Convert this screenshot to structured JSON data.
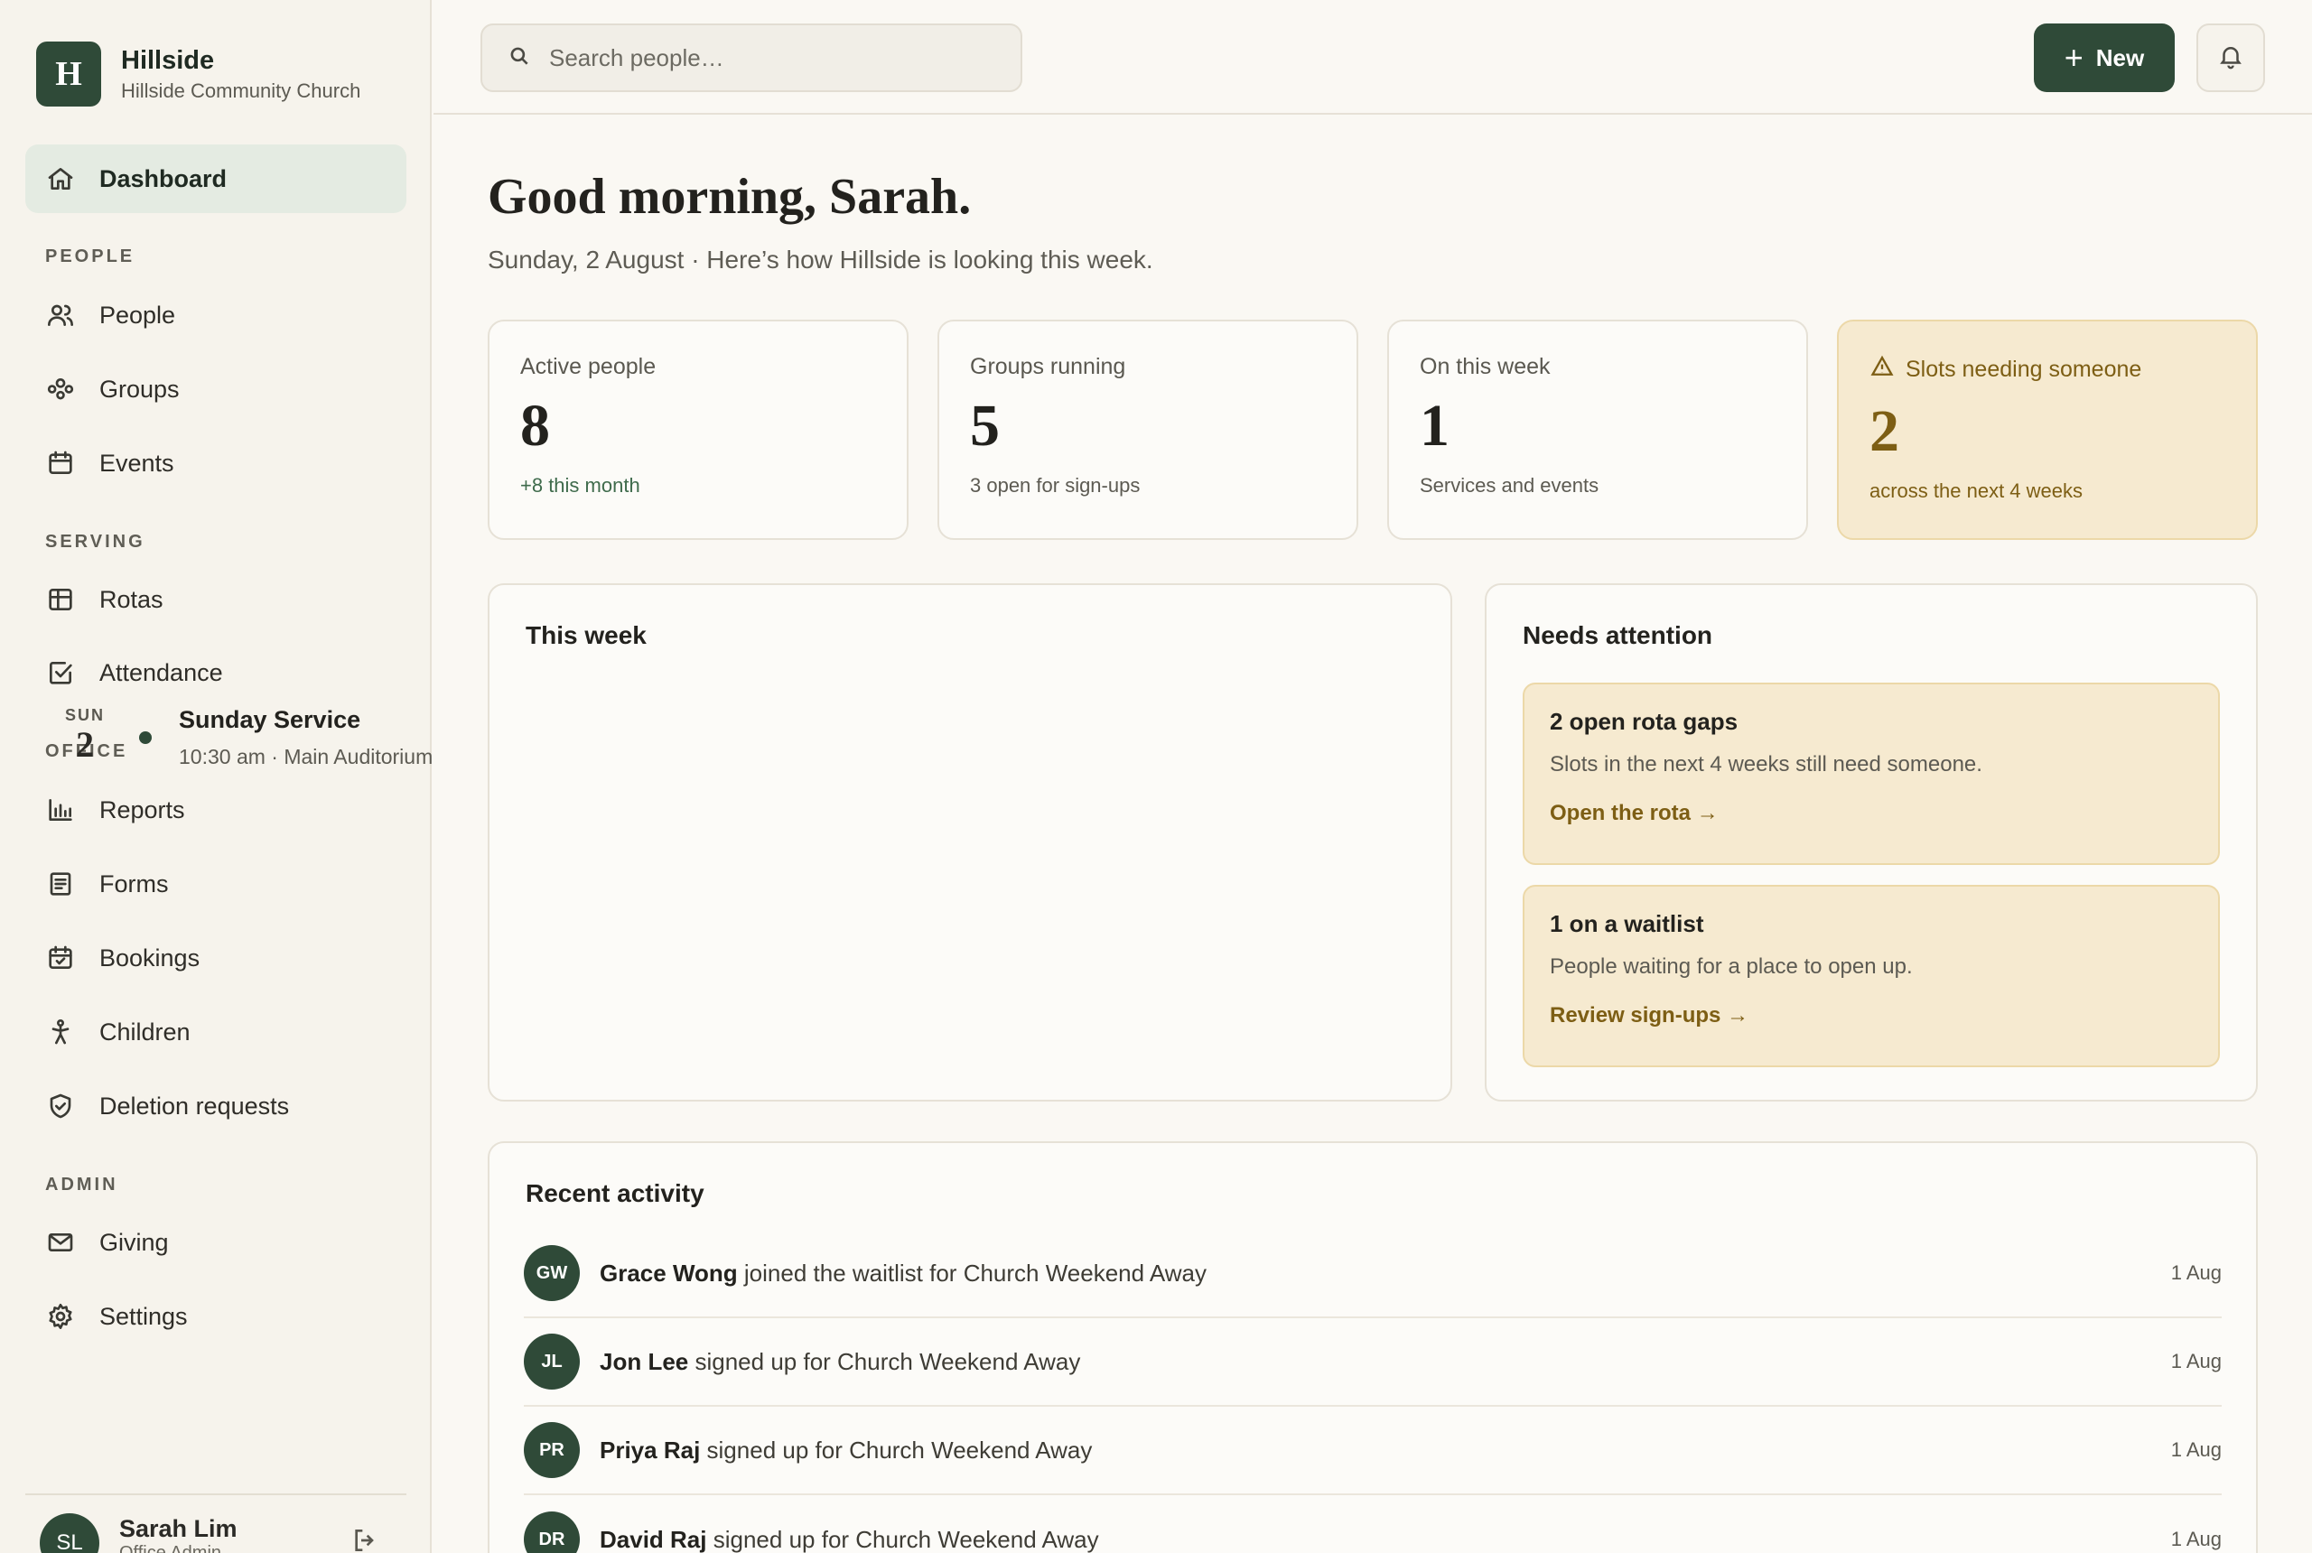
{
  "brand": {
    "logo_letter": "H",
    "name": "Hillside",
    "subtitle": "Hillside Community Church"
  },
  "sidebar": {
    "dashboard": "Dashboard",
    "sections": {
      "people": "PEOPLE",
      "serving": "SERVING",
      "office": "OFFICE",
      "admin": "ADMIN"
    },
    "items": {
      "people": "People",
      "groups": "Groups",
      "events": "Events",
      "rotas": "Rotas",
      "attendance": "Attendance",
      "reports": "Reports",
      "forms": "Forms",
      "bookings": "Bookings",
      "children": "Children",
      "deletion": "Deletion requests",
      "giving": "Giving",
      "settings": "Settings"
    },
    "user": {
      "initials": "SL",
      "name": "Sarah Lim",
      "role": "Office Admin"
    }
  },
  "topbar": {
    "search_placeholder": "Search people…",
    "new_label": "New"
  },
  "main": {
    "greeting": "Good morning, Sarah.",
    "subline": "Sunday, 2 August · Here’s how Hillside is looking this week.",
    "stats": [
      {
        "label": "Active people",
        "value": "8",
        "note": "+8 this month"
      },
      {
        "label": "Groups running",
        "value": "5",
        "note": "3 open for sign-ups"
      },
      {
        "label": "On this week",
        "value": "1",
        "note": "Services and events"
      },
      {
        "label": "Slots needing someone",
        "value": "2",
        "note": "across the next 4 weeks"
      }
    ],
    "this_week": {
      "title": "This week",
      "events": [
        {
          "dow": "SUN",
          "day": "2",
          "name": "Sunday Service",
          "meta": "10:30 am · Main Auditorium"
        }
      ]
    },
    "needs_attention": {
      "title": "Needs attention",
      "items": [
        {
          "title": "2 open rota gaps",
          "desc": "Slots in the next 4 weeks still need someone.",
          "link": "Open the rota →"
        },
        {
          "title": "1 on a waitlist",
          "desc": "People waiting for a place to open up.",
          "link": "Review sign-ups →"
        }
      ]
    },
    "recent_activity": {
      "title": "Recent activity",
      "items": [
        {
          "initials": "GW",
          "name": "Grace Wong",
          "action": "joined the waitlist for Church Weekend Away",
          "date": "1 Aug"
        },
        {
          "initials": "JL",
          "name": "Jon Lee",
          "action": "signed up for Church Weekend Away",
          "date": "1 Aug"
        },
        {
          "initials": "PR",
          "name": "Priya Raj",
          "action": "signed up for Church Weekend Away",
          "date": "1 Aug"
        },
        {
          "initials": "DR",
          "name": "David Raj",
          "action": "signed up for Church Weekend Away",
          "date": "1 Aug"
        }
      ]
    }
  }
}
